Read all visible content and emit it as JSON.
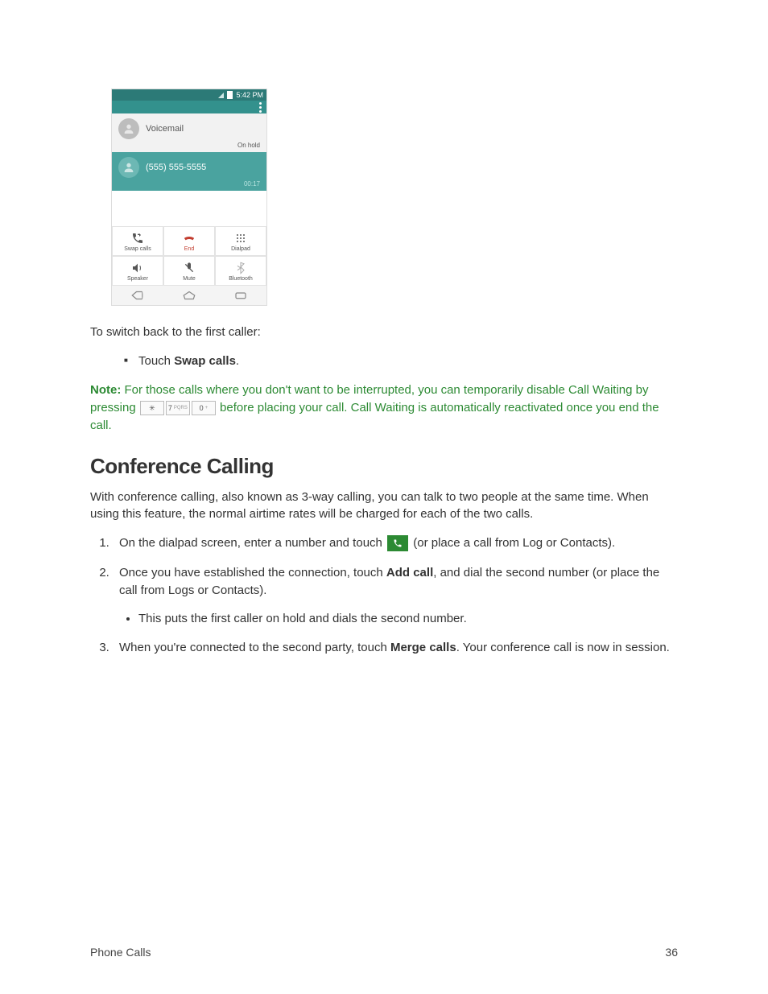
{
  "screenshot": {
    "status_time": "5:42 PM",
    "call1_name": "Voicemail",
    "call1_status": "On hold",
    "call2_name": "(555) 555-5555",
    "call2_status": "00:17",
    "btn_swap": "Swap calls",
    "btn_end": "End",
    "btn_dialpad": "Dialpad",
    "btn_speaker": "Speaker",
    "btn_mute": "Mute",
    "btn_bluetooth": "Bluetooth"
  },
  "body": {
    "intro": "To switch back to the first caller:",
    "bullet_prefix": "Touch ",
    "bullet_bold": "Swap calls",
    "bullet_suffix": ".",
    "note_label": "Note:",
    "note_text1": " For those calls where you don't want to be interrupted, you can temporarily disable Call Waiting by pressing ",
    "key_star": "✳",
    "key_7_main": "7",
    "key_7_sub": "PQRS",
    "key_0_main": "0",
    "key_0_sub": "+",
    "note_text2": " before placing your call. Call Waiting is automatically reactivated once you end the call."
  },
  "heading": "Conference Calling",
  "conf_intro": "With conference calling, also known as 3-way calling, you can talk to two people at the same time. When using this feature, the normal airtime rates will be charged for each of the two calls.",
  "steps": {
    "s1_a": "On the dialpad screen, enter a number and touch ",
    "s1_b": " (or place a call from Log or Contacts).",
    "s2_a": "Once you have established the connection, touch ",
    "s2_bold": "Add call",
    "s2_b": ", and dial the second number (or place the call from Logs or Contacts).",
    "s2_sub": "This puts the first caller on hold and dials the second number.",
    "s3_a": "When you're connected to the second party, touch ",
    "s3_bold": "Merge calls",
    "s3_b": ". Your conference call is now in session."
  },
  "footer": {
    "section": "Phone Calls",
    "page": "36"
  }
}
